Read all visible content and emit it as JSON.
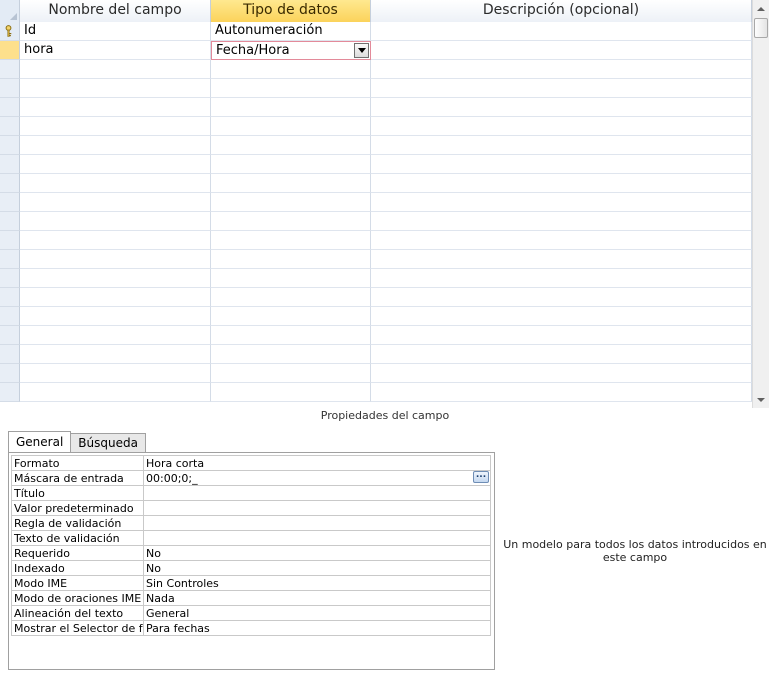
{
  "grid": {
    "columns": [
      "Nombre del campo",
      "Tipo de datos",
      "Descripción (opcional)"
    ],
    "rows": [
      {
        "field": "Id",
        "type": "Autonumeración",
        "description": "",
        "primary_key": true
      },
      {
        "field": "hora",
        "type": "Fecha/Hora",
        "description": "",
        "current": true
      }
    ],
    "empty_rows": 18
  },
  "properties": {
    "title": "Propiedades del campo",
    "tabs": [
      "General",
      "Búsqueda"
    ],
    "active_tab": "General",
    "rows": [
      {
        "name": "Formato",
        "value": "Hora corta"
      },
      {
        "name": "Máscara de entrada",
        "value": "00:00;0;_"
      },
      {
        "name": "Título",
        "value": ""
      },
      {
        "name": "Valor predeterminado",
        "value": ""
      },
      {
        "name": "Regla de validación",
        "value": ""
      },
      {
        "name": "Texto de validación",
        "value": ""
      },
      {
        "name": "Requerido",
        "value": "No"
      },
      {
        "name": "Indexado",
        "value": "No"
      },
      {
        "name": "Modo IME",
        "value": "Sin Controles"
      },
      {
        "name": "Modo de oraciones IME",
        "value": "Nada"
      },
      {
        "name": "Alineación del texto",
        "value": "General"
      },
      {
        "name": "Mostrar el Selector de fec",
        "value": "Para fechas"
      }
    ],
    "builder_label": "...",
    "help": "Un modelo para todos los datos introducidos en este campo"
  },
  "colors": {
    "active_header": "#fbd35b",
    "current_row_selector": "#fde08c",
    "editing_border": "#e38a9a"
  }
}
